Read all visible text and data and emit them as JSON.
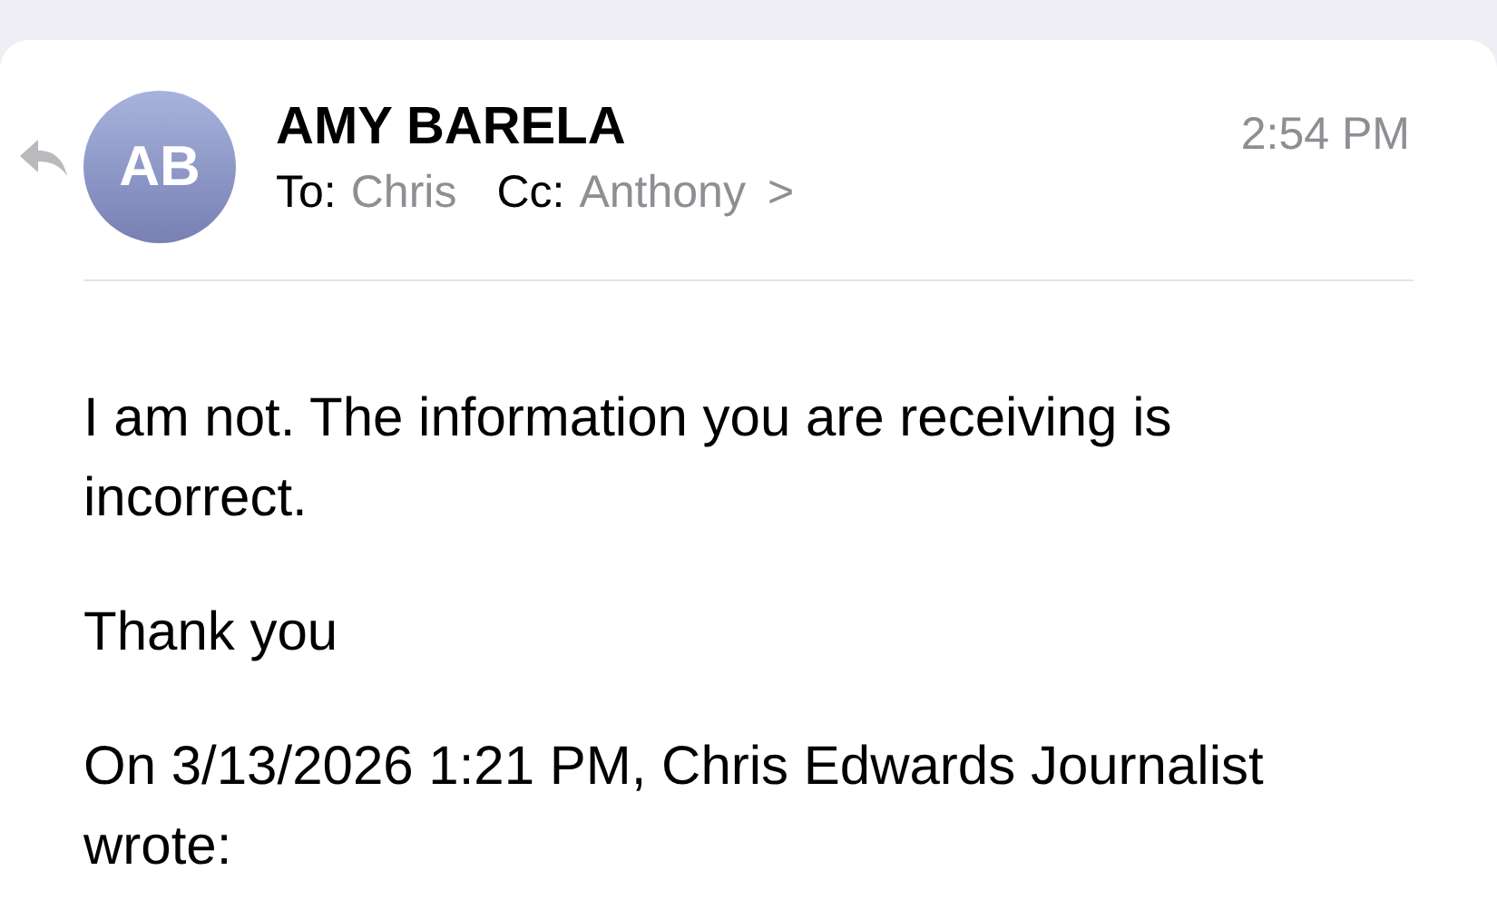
{
  "message": {
    "sender": "AMY BARELA",
    "initials": "AB",
    "to_label": "To:",
    "to": "Chris",
    "cc_label": "Cc:",
    "cc": "Anthony",
    "expand": ">",
    "time": "2:54 PM"
  },
  "body": [
    "I am not. The information you are receiving is incorrect.",
    "Thank you",
    "On 3/13/2026 1:21 PM, Chris Edwards Journalist wrote:"
  ]
}
